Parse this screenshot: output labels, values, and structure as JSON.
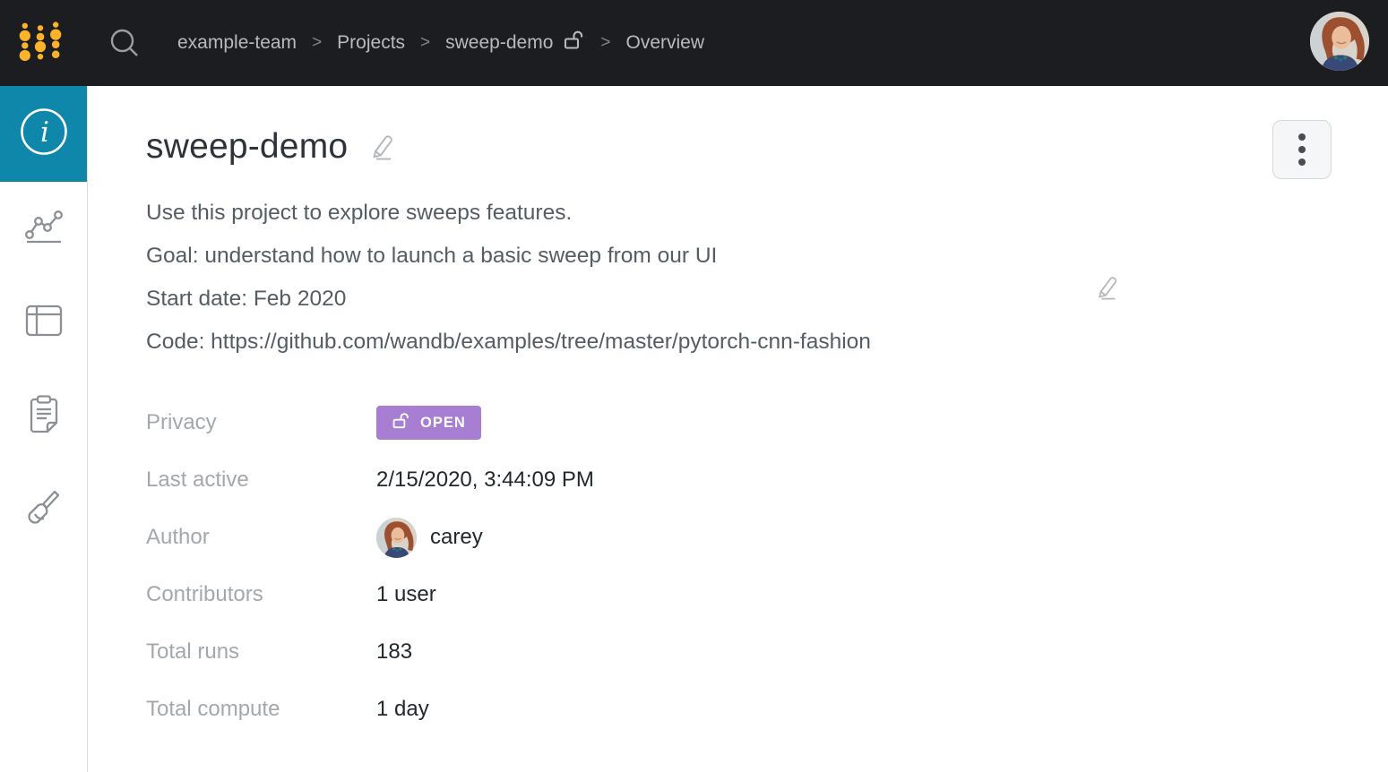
{
  "topbar": {
    "separator": ">",
    "breadcrumb": [
      {
        "label": "example-team"
      },
      {
        "label": "Projects"
      },
      {
        "label": "sweep-demo",
        "icon": "unlock-icon"
      },
      {
        "label": "Overview"
      }
    ]
  },
  "sidebar": {
    "items": [
      {
        "name": "overview",
        "icon": "info-icon",
        "active": true
      },
      {
        "name": "workspace",
        "icon": "line-chart-icon",
        "active": false
      },
      {
        "name": "table",
        "icon": "table-icon",
        "active": false
      },
      {
        "name": "reports",
        "icon": "clipboard-icon",
        "active": false
      },
      {
        "name": "sweeps",
        "icon": "broom-icon",
        "active": false
      }
    ]
  },
  "main": {
    "title": "sweep-demo",
    "description_lines": [
      "Use this project to explore sweeps features.",
      "Goal: understand how to launch a basic sweep from our UI",
      "Start date: Feb 2020",
      "Code: https://github.com/wandb/examples/tree/master/pytorch-cnn-fashion"
    ],
    "details": [
      {
        "label": "Privacy",
        "value": "OPEN",
        "type": "badge"
      },
      {
        "label": "Last active",
        "value": "2/15/2020, 3:44:09 PM"
      },
      {
        "label": "Author",
        "value": "carey",
        "type": "user"
      },
      {
        "label": "Contributors",
        "value": "1 user"
      },
      {
        "label": "Total runs",
        "value": "183"
      },
      {
        "label": "Total compute",
        "value": "1 day"
      }
    ]
  },
  "colors": {
    "topbar_bg": "#1b1d21",
    "accent_teal": "#0e87ab",
    "badge_purple": "#a77ed2",
    "logo_gold": "#fcb32c",
    "label_gray": "#a4a8ad",
    "value_dark": "#23282e"
  }
}
